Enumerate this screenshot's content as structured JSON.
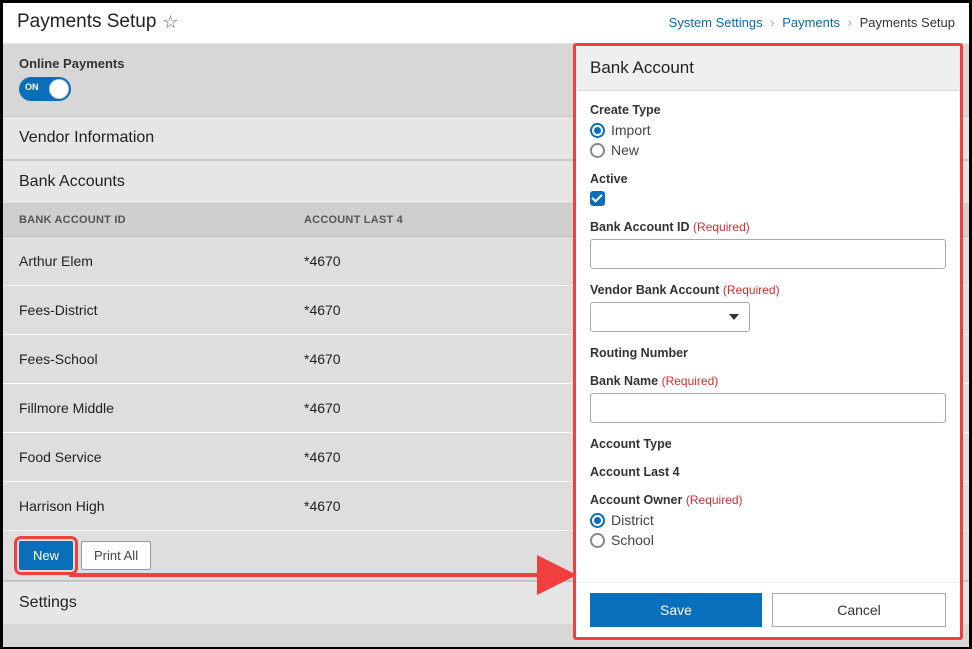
{
  "header": {
    "title": "Payments Setup",
    "breadcrumb": {
      "l1": "System Settings",
      "l2": "Payments",
      "l3": "Payments Setup"
    }
  },
  "main": {
    "online_payments_label": "Online Payments",
    "toggle_on_text": "ON",
    "section_vendor": "Vendor Information",
    "section_bank": "Bank Accounts",
    "columns": {
      "id": "BANK ACCOUNT ID",
      "last4": "ACCOUNT LAST 4"
    },
    "rows": [
      {
        "id": "Arthur Elem",
        "last4": "*4670"
      },
      {
        "id": "Fees-District",
        "last4": "*4670"
      },
      {
        "id": "Fees-School",
        "last4": "*4670"
      },
      {
        "id": "Fillmore Middle",
        "last4": "*4670"
      },
      {
        "id": "Food Service",
        "last4": "*4670"
      },
      {
        "id": "Harrison High",
        "last4": "*4670"
      }
    ],
    "btn_new": "New",
    "btn_print": "Print All",
    "section_settings": "Settings"
  },
  "panel": {
    "title": "Bank Account",
    "create_type_label": "Create Type",
    "opt_import": "Import",
    "opt_new": "New",
    "active_label": "Active",
    "bank_account_id_label": "Bank Account ID",
    "vendor_bank_label": "Vendor Bank Account",
    "routing_label": "Routing Number",
    "bank_name_label": "Bank Name",
    "account_type_label": "Account Type",
    "account_last4_label": "Account Last 4",
    "account_owner_label": "Account Owner",
    "opt_district": "District",
    "opt_school": "School",
    "required_text": "(Required)",
    "btn_save": "Save",
    "btn_cancel": "Cancel"
  },
  "colors": {
    "accent": "#0a6fba",
    "highlight": "#f03f3f"
  }
}
